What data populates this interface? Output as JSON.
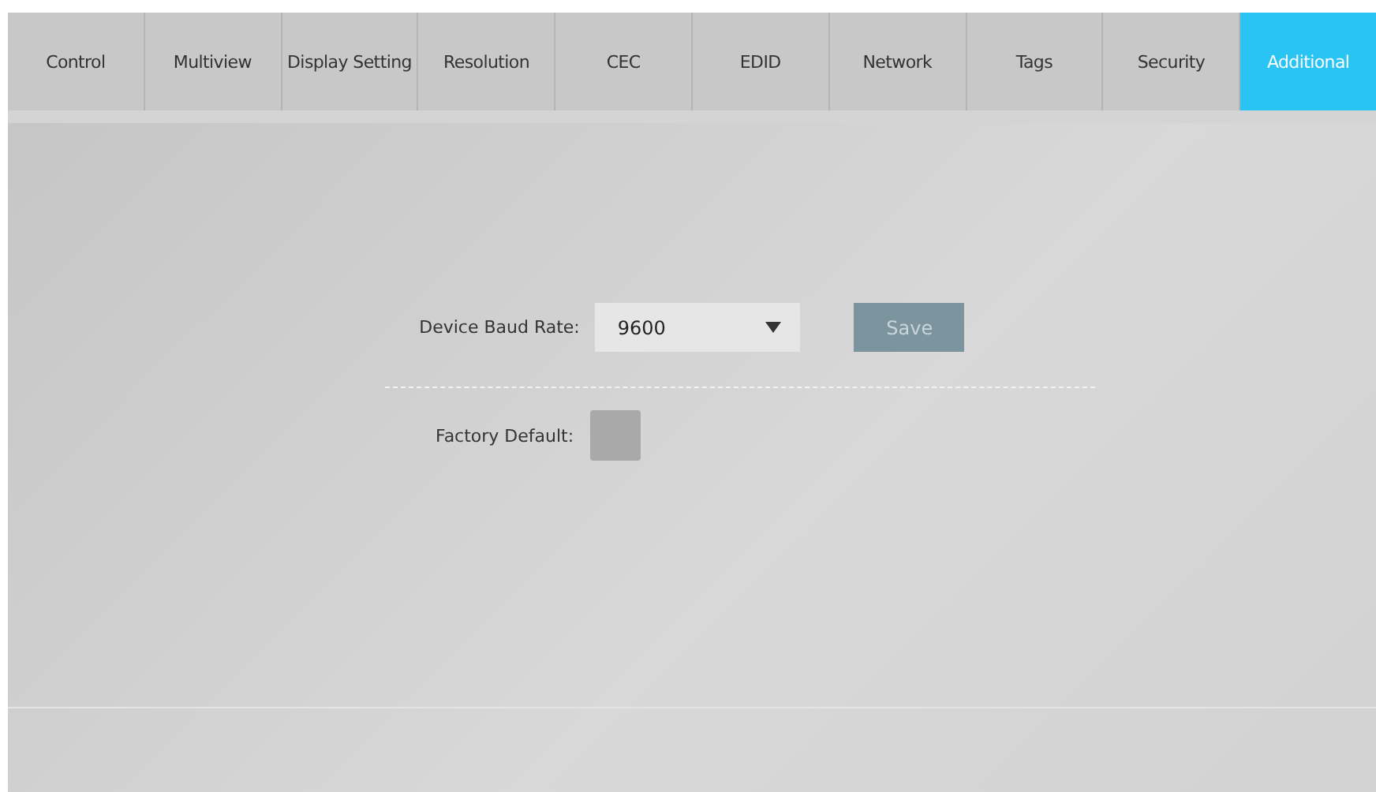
{
  "tabs": [
    {
      "label": "Control",
      "selected": false
    },
    {
      "label": "Multiview",
      "selected": false
    },
    {
      "label": "Display Setting",
      "selected": false
    },
    {
      "label": "Resolution",
      "selected": false
    },
    {
      "label": "CEC",
      "selected": false
    },
    {
      "label": "EDID",
      "selected": false
    },
    {
      "label": "Network",
      "selected": false
    },
    {
      "label": "Tags",
      "selected": false
    },
    {
      "label": "Security",
      "selected": false
    },
    {
      "label": "Additional",
      "selected": true
    }
  ],
  "baud_rate": {
    "label": "Device Baud Rate:",
    "value": "9600",
    "button": "Save"
  },
  "factory_default": {
    "label": "Factory Default:",
    "checked": false
  }
}
